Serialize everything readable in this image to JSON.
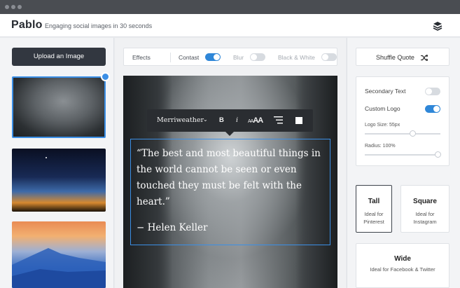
{
  "app": {
    "name": "Pablo",
    "tagline": "Engaging social images in 30 seconds"
  },
  "sidebar_left": {
    "upload_label": "Upload an Image",
    "thumbnails": [
      "misty-canyon",
      "night-sky-sunset",
      "mountain-sunset-blue"
    ],
    "selected_index": 0
  },
  "toolbar": {
    "effects": "Effects",
    "contrast": "Contast",
    "contrast_on": true,
    "blur": "Blur",
    "blur_on": false,
    "black_white": "Black & White",
    "black_white_on": false
  },
  "format_bar": {
    "font": "Merriweather",
    "bold": "B",
    "italic": "i",
    "size": "AA"
  },
  "quote": {
    "text": "“The best and most beautiful things in the world cannot be seen or even touched they must be felt with the heart.”",
    "author": "− Helen Keller"
  },
  "sidebar_right": {
    "shuffle_label": "Shuffle Quote",
    "secondary_text": "Secondary Text",
    "secondary_text_on": false,
    "custom_logo": "Custom Logo",
    "custom_logo_on": true,
    "logo_size": "Logo Size: 55px",
    "radius": "Radius: 100%",
    "sizes": [
      {
        "title": "Tall",
        "sub": "Ideal for Pinterest"
      },
      {
        "title": "Square",
        "sub": "Ideal for Instagram"
      },
      {
        "title": "Wide",
        "sub": "Ideal for Facebook & Twitter"
      }
    ]
  },
  "colors": {
    "accent": "#2f87d8",
    "dark_button": "#323740",
    "chrome": "#4a4d52"
  }
}
